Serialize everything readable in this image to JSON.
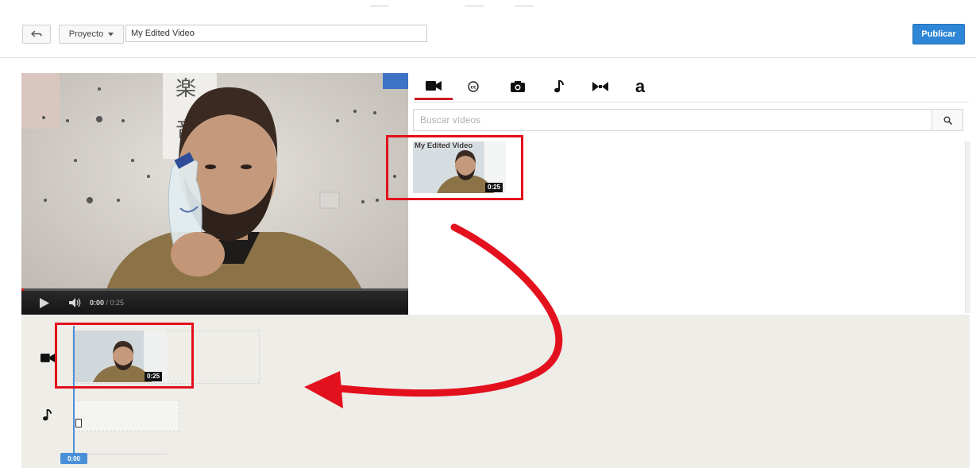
{
  "toolbar": {
    "back_icon": "undo-arrow-icon",
    "project_label": "Proyecto",
    "project_dropdown_icon": "caret-down-icon",
    "title_value": "My Edited Video",
    "publish_label": "Publicar"
  },
  "player": {
    "current_time": "0:00",
    "duration": "/ 0:25",
    "play_icon": "play-icon",
    "volume_icon": "volume-icon",
    "progress_fraction": 0
  },
  "tabs": [
    {
      "name": "video",
      "icon": "video-camera-icon",
      "active": true
    },
    {
      "name": "creative-commons",
      "icon": "creative-commons-icon",
      "active": false
    },
    {
      "name": "photos",
      "icon": "photo-camera-icon",
      "active": false
    },
    {
      "name": "audio",
      "icon": "music-note-icon",
      "active": false
    },
    {
      "name": "transitions",
      "icon": "bowtie-transition-icon",
      "active": false
    },
    {
      "name": "text",
      "icon": "text-a-icon",
      "label": "a",
      "active": false
    }
  ],
  "search": {
    "placeholder": "Buscar vídeos",
    "value": "",
    "button_icon": "search-icon"
  },
  "library": {
    "items": [
      {
        "title": "My Edited Video",
        "duration": "0:25"
      }
    ]
  },
  "timeline": {
    "clips": [
      {
        "duration": "0:25"
      }
    ],
    "playhead_time": "0:00",
    "video_track_icon": "video-camera-icon",
    "audio_track_icon": "music-note-icon"
  },
  "colors": {
    "accent_blue": "#2f86d6",
    "tab_active": "#cc181e",
    "annotation_red": "#e3101d",
    "timeline_bg": "#eeede8"
  }
}
